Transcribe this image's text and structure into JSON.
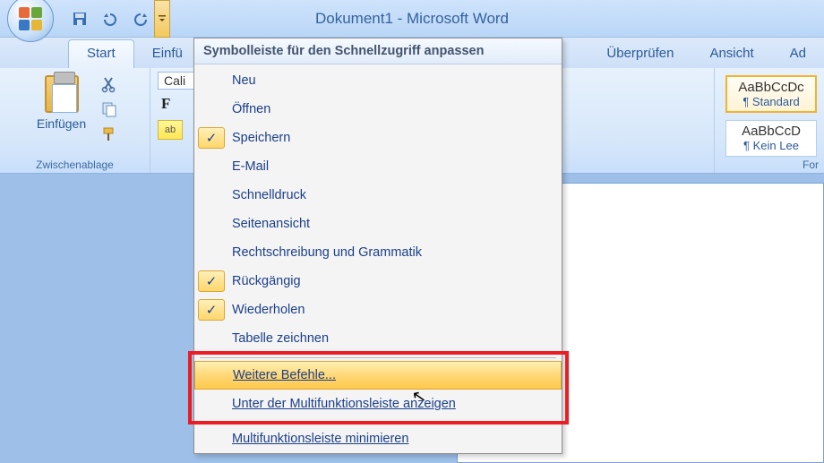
{
  "window": {
    "title": "Dokument1 - Microsoft Word"
  },
  "tabs": {
    "start": "Start",
    "einfuegen": "Einfü",
    "ueberpruefen": "Überprüfen",
    "ansicht": "Ansicht",
    "addins": "Ad"
  },
  "clipboard": {
    "paste": "Einfügen",
    "group_label": "Zwischenablage"
  },
  "font": {
    "family": "Cali",
    "bold_label": "F",
    "highlight_label": "ab"
  },
  "styles": {
    "sample": "AaBbCcDc",
    "standard": "¶ Standard",
    "sample2": "AaBbCcD",
    "kein": "¶ Kein Lee",
    "group_label": "For"
  },
  "qat_menu": {
    "title": "Symbolleiste für den Schnellzugriff anpassen",
    "items": [
      {
        "label": "Neu",
        "checked": false
      },
      {
        "label": "Öffnen",
        "checked": false
      },
      {
        "label": "Speichern",
        "checked": true
      },
      {
        "label": "E-Mail",
        "checked": false
      },
      {
        "label": "Schnelldruck",
        "checked": false
      },
      {
        "label": "Seitenansicht",
        "checked": false
      },
      {
        "label": "Rechtschreibung und Grammatik",
        "checked": false
      },
      {
        "label": "Rückgängig",
        "checked": true
      },
      {
        "label": "Wiederholen",
        "checked": true
      },
      {
        "label": "Tabelle zeichnen",
        "checked": false
      }
    ],
    "more_commands": "Weitere Befehle...",
    "below_ribbon": "Unter der Multifunktionsleiste anzeigen",
    "minimize_ribbon": "Multifunktionsleiste minimieren"
  }
}
